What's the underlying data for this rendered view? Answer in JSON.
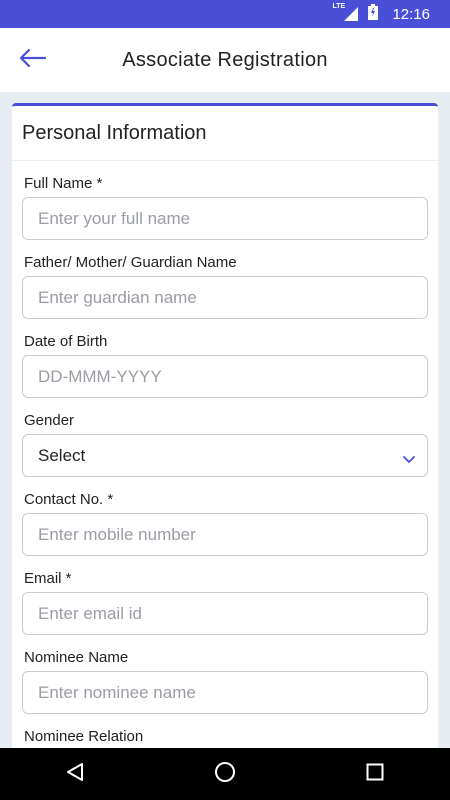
{
  "status_bar": {
    "network": "LTE",
    "time": "12:16"
  },
  "app_bar": {
    "title": "Associate Registration"
  },
  "section": {
    "title": "Personal Information"
  },
  "fields": [
    {
      "label": "Full Name *",
      "placeholder": "Enter your full name"
    },
    {
      "label": "Father/ Mother/ Guardian Name",
      "placeholder": "Enter guardian name"
    },
    {
      "label": "Date of Birth",
      "placeholder": "DD-MMM-YYYY"
    },
    {
      "label": "Gender",
      "value": "Select"
    },
    {
      "label": "Contact No. *",
      "placeholder": "Enter mobile number"
    },
    {
      "label": "Email *",
      "placeholder": "Enter email id"
    },
    {
      "label": "Nominee Name",
      "placeholder": "Enter nominee name"
    },
    {
      "label": "Nominee Relation",
      "placeholder": ""
    }
  ],
  "colors": {
    "accent": "#4a4fd8",
    "border": "#c9ccd3",
    "placeholder": "#9a9da4"
  },
  "icons": {
    "back": "arrow-left-icon",
    "dropdown": "chevron-down-icon"
  }
}
